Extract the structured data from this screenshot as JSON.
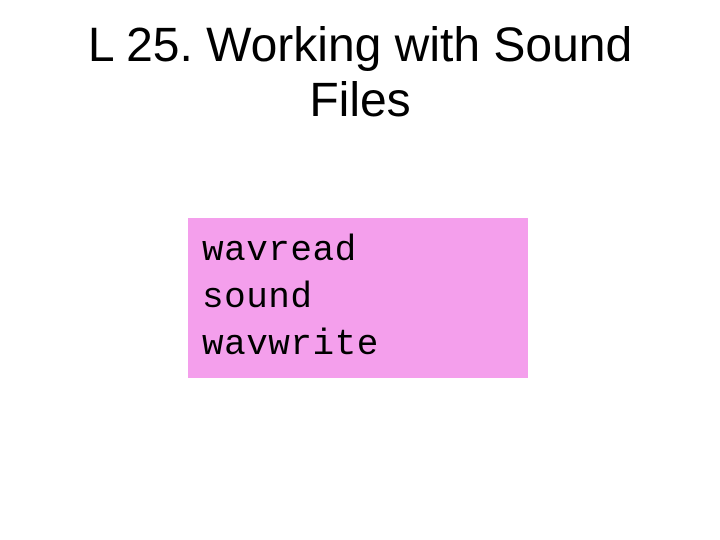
{
  "title": "L 25. Working with Sound Files",
  "code": {
    "line1": "wavread",
    "line2": "sound",
    "line3": "wavwrite"
  }
}
